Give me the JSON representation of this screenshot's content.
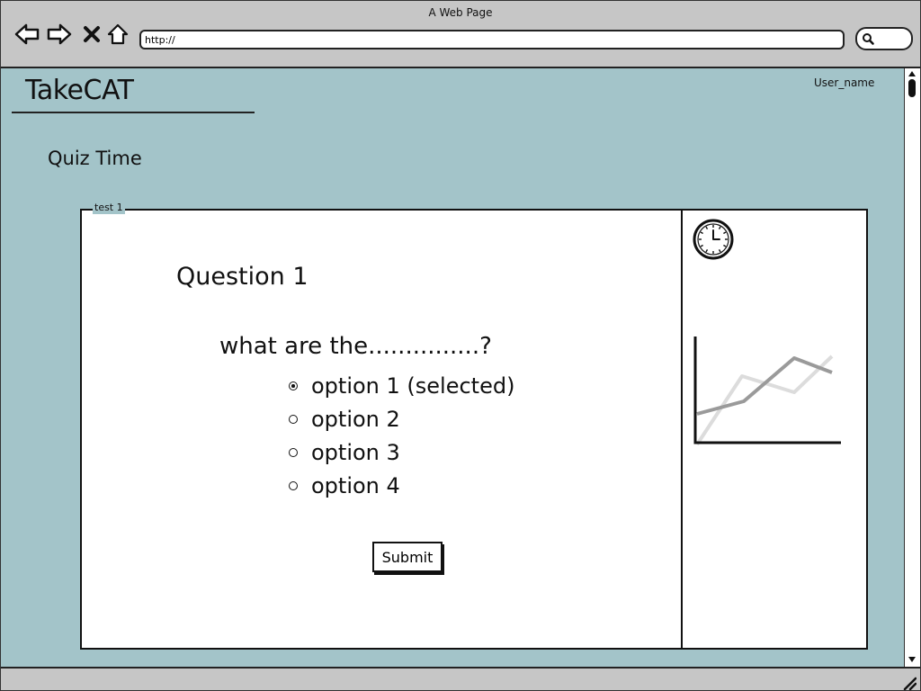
{
  "window": {
    "title": "A Web Page"
  },
  "browser": {
    "url": "http://",
    "icons": [
      "back-icon",
      "forward-icon",
      "stop-icon",
      "home-icon",
      "search-icon"
    ]
  },
  "header": {
    "logo": "TakeCAT",
    "user_name": "User_name"
  },
  "page": {
    "heading": "Quiz Time"
  },
  "quiz": {
    "group_label": "test 1",
    "question_title": "Question 1",
    "question_text": "what are the...............?",
    "options": [
      {
        "label": "option 1 (selected)",
        "selected": true
      },
      {
        "label": "option 2",
        "selected": false
      },
      {
        "label": "option 3",
        "selected": false
      },
      {
        "label": "option 4",
        "selected": false
      }
    ],
    "submit_label": "Submit"
  },
  "sidebar": {
    "icons": [
      "clock-icon",
      "line-chart-icon"
    ]
  },
  "colors": {
    "content_bg": "#a3c4c9",
    "chrome_bg": "#c6c6c6",
    "panel_bg": "#ffffff"
  }
}
